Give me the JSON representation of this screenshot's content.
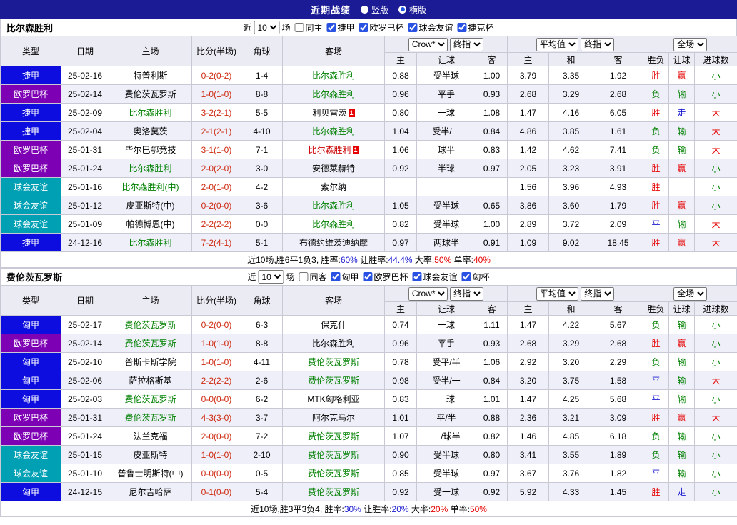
{
  "topbar": {
    "title": "近期战绩",
    "options": [
      {
        "label": "竖版",
        "selected": false
      },
      {
        "label": "横版",
        "selected": true
      }
    ]
  },
  "colors": {
    "topbar_bg": "#1b1b96",
    "header_bg": "#ebebf3",
    "row_alt": "#eeeff9",
    "team_highlight": "#008000",
    "score": "#cf2a10",
    "win": "#e60000",
    "draw": "#1a1ad0",
    "lose": "#008000",
    "leagues": {
      "捷甲": "#0d0de0",
      "欧罗巴杯": "#7e00b4",
      "球会友谊": "#00a0b4",
      "匈甲": "#0d0de0",
      "匈杯": "#00a0b4"
    }
  },
  "table_headers": {
    "type": "类型",
    "date": "日期",
    "home": "主场",
    "score": "比分(半场)",
    "corner": "角球",
    "away": "客场",
    "select_crow": "Crow*",
    "select_final": "终指",
    "select_avg": "平均值",
    "select_full": "全场",
    "sub": [
      "主",
      "让球",
      "客",
      "主",
      "和",
      "客",
      "胜负",
      "让球",
      "进球数"
    ]
  },
  "sections": [
    {
      "team": "比尔森胜利",
      "filter": {
        "prefix": "近",
        "count": "10",
        "suffix": "场",
        "same": {
          "label": "同主",
          "checked": false
        },
        "leagues": [
          {
            "label": "捷甲",
            "checked": true
          },
          {
            "label": "欧罗巴杯",
            "checked": true
          },
          {
            "label": "球会友谊",
            "checked": true
          },
          {
            "label": "捷克杯",
            "checked": true
          }
        ]
      },
      "rows": [
        {
          "league": "捷甲",
          "date": "25-02-16",
          "home": {
            "name": "特普利斯"
          },
          "score": "0-2(0-2)",
          "corner": "1-4",
          "away": {
            "name": "比尔森胜利",
            "green": true
          },
          "crow": [
            "0.88",
            "受半球",
            "1.00"
          ],
          "avg": [
            "3.79",
            "3.35",
            "1.92"
          ],
          "wdl": [
            "胜",
            "r"
          ],
          "handi": [
            "赢",
            "r"
          ],
          "goal": [
            "小",
            "g"
          ]
        },
        {
          "league": "欧罗巴杯",
          "date": "25-02-14",
          "home": {
            "name": "费伦茨瓦罗斯"
          },
          "score": "1-0(1-0)",
          "corner": "8-8",
          "away": {
            "name": "比尔森胜利",
            "green": true
          },
          "crow": [
            "0.96",
            "平手",
            "0.93"
          ],
          "avg": [
            "2.68",
            "3.29",
            "2.68"
          ],
          "wdl": [
            "负",
            "g"
          ],
          "handi": [
            "输",
            "g"
          ],
          "goal": [
            "小",
            "g"
          ]
        },
        {
          "league": "捷甲",
          "date": "25-02-09",
          "home": {
            "name": "比尔森胜利",
            "green": true
          },
          "score": "3-2(2-1)",
          "corner": "5-5",
          "away": {
            "name": "利贝雷茨",
            "redcard": "1"
          },
          "crow": [
            "0.80",
            "一球",
            "1.08"
          ],
          "avg": [
            "1.47",
            "4.16",
            "6.05"
          ],
          "wdl": [
            "胜",
            "r"
          ],
          "handi": [
            "走",
            "b"
          ],
          "goal": [
            "大",
            "r"
          ]
        },
        {
          "league": "捷甲",
          "date": "25-02-04",
          "home": {
            "name": "奥洛莫茨"
          },
          "score": "2-1(2-1)",
          "corner": "4-10",
          "away": {
            "name": "比尔森胜利",
            "green": true
          },
          "crow": [
            "1.04",
            "受半/一",
            "0.84"
          ],
          "avg": [
            "4.86",
            "3.85",
            "1.61"
          ],
          "wdl": [
            "负",
            "g"
          ],
          "handi": [
            "输",
            "g"
          ],
          "goal": [
            "大",
            "r"
          ]
        },
        {
          "league": "欧罗巴杯",
          "date": "25-01-31",
          "home": {
            "name": "毕尔巴鄂竞技"
          },
          "score": "3-1(1-0)",
          "corner": "7-1",
          "away": {
            "name": "比尔森胜利",
            "red": true,
            "redcard": "1"
          },
          "crow": [
            "1.06",
            "球半",
            "0.83"
          ],
          "avg": [
            "1.42",
            "4.62",
            "7.41"
          ],
          "wdl": [
            "负",
            "g"
          ],
          "handi": [
            "输",
            "g"
          ],
          "goal": [
            "大",
            "r"
          ]
        },
        {
          "league": "欧罗巴杯",
          "date": "25-01-24",
          "home": {
            "name": "比尔森胜利",
            "green": true
          },
          "score": "2-0(2-0)",
          "corner": "3-0",
          "away": {
            "name": "安德莱赫特"
          },
          "crow": [
            "0.92",
            "半球",
            "0.97"
          ],
          "avg": [
            "2.05",
            "3.23",
            "3.91"
          ],
          "wdl": [
            "胜",
            "r"
          ],
          "handi": [
            "赢",
            "r"
          ],
          "goal": [
            "小",
            "g"
          ]
        },
        {
          "league": "球会友谊",
          "date": "25-01-16",
          "home": {
            "name": "比尔森胜利(中)",
            "green": true
          },
          "score": "2-0(1-0)",
          "corner": "4-2",
          "away": {
            "name": "索尔纳"
          },
          "crow": [
            "",
            "",
            ""
          ],
          "avg": [
            "1.56",
            "3.96",
            "4.93"
          ],
          "wdl": [
            "胜",
            "r"
          ],
          "handi": [
            "",
            ""
          ],
          "goal": [
            "小",
            "g"
          ]
        },
        {
          "league": "球会友谊",
          "date": "25-01-12",
          "home": {
            "name": "皮亚斯特(中)"
          },
          "score": "0-2(0-0)",
          "corner": "3-6",
          "away": {
            "name": "比尔森胜利",
            "green": true
          },
          "crow": [
            "1.05",
            "受半球",
            "0.65"
          ],
          "avg": [
            "3.86",
            "3.60",
            "1.79"
          ],
          "wdl": [
            "胜",
            "r"
          ],
          "handi": [
            "赢",
            "r"
          ],
          "goal": [
            "小",
            "g"
          ]
        },
        {
          "league": "球会友谊",
          "date": "25-01-09",
          "home": {
            "name": "帕德博恩(中)"
          },
          "score": "2-2(2-2)",
          "corner": "0-0",
          "away": {
            "name": "比尔森胜利",
            "green": true
          },
          "crow": [
            "0.82",
            "受半球",
            "1.00"
          ],
          "avg": [
            "2.89",
            "3.72",
            "2.09"
          ],
          "wdl": [
            "平",
            "b"
          ],
          "handi": [
            "输",
            "g"
          ],
          "goal": [
            "大",
            "r"
          ]
        },
        {
          "league": "捷甲",
          "date": "24-12-16",
          "home": {
            "name": "比尔森胜利",
            "green": true
          },
          "score": "7-2(4-1)",
          "corner": "5-1",
          "away": {
            "name": "布德约维茨迪纳摩"
          },
          "crow": [
            "0.97",
            "两球半",
            "0.91"
          ],
          "avg": [
            "1.09",
            "9.02",
            "18.45"
          ],
          "wdl": [
            "胜",
            "r"
          ],
          "handi": [
            "赢",
            "r"
          ],
          "goal": [
            "大",
            "r"
          ]
        }
      ],
      "summary": [
        {
          "t": "近10场,胜6平1负3, 胜率:",
          "c": "k"
        },
        {
          "t": "60%",
          "c": "b"
        },
        {
          "t": " 让胜率:",
          "c": "k"
        },
        {
          "t": "44.4%",
          "c": "b"
        },
        {
          "t": " 大率:",
          "c": "k"
        },
        {
          "t": "50%",
          "c": "r"
        },
        {
          "t": " 单率:",
          "c": "k"
        },
        {
          "t": "40%",
          "c": "r"
        }
      ]
    },
    {
      "team": "费伦茨瓦罗斯",
      "filter": {
        "prefix": "近",
        "count": "10",
        "suffix": "场",
        "same": {
          "label": "同客",
          "checked": false
        },
        "leagues": [
          {
            "label": "匈甲",
            "checked": true
          },
          {
            "label": "欧罗巴杯",
            "checked": true
          },
          {
            "label": "球会友谊",
            "checked": true
          },
          {
            "label": "匈杯",
            "checked": true
          }
        ]
      },
      "rows": [
        {
          "league": "匈甲",
          "date": "25-02-17",
          "home": {
            "name": "费伦茨瓦罗斯",
            "green": true
          },
          "score": "0-2(0-0)",
          "corner": "6-3",
          "away": {
            "name": "保克什"
          },
          "crow": [
            "0.74",
            "一球",
            "1.11"
          ],
          "avg": [
            "1.47",
            "4.22",
            "5.67"
          ],
          "wdl": [
            "负",
            "g"
          ],
          "handi": [
            "输",
            "g"
          ],
          "goal": [
            "小",
            "g"
          ]
        },
        {
          "league": "欧罗巴杯",
          "date": "25-02-14",
          "home": {
            "name": "费伦茨瓦罗斯",
            "green": true
          },
          "score": "1-0(1-0)",
          "corner": "8-8",
          "away": {
            "name": "比尔森胜利"
          },
          "crow": [
            "0.96",
            "平手",
            "0.93"
          ],
          "avg": [
            "2.68",
            "3.29",
            "2.68"
          ],
          "wdl": [
            "胜",
            "r"
          ],
          "handi": [
            "赢",
            "r"
          ],
          "goal": [
            "小",
            "g"
          ]
        },
        {
          "league": "匈甲",
          "date": "25-02-10",
          "home": {
            "name": "普斯卡斯学院"
          },
          "score": "1-0(1-0)",
          "corner": "4-11",
          "away": {
            "name": "费伦茨瓦罗斯",
            "green": true
          },
          "crow": [
            "0.78",
            "受平/半",
            "1.06"
          ],
          "avg": [
            "2.92",
            "3.20",
            "2.29"
          ],
          "wdl": [
            "负",
            "g"
          ],
          "handi": [
            "输",
            "g"
          ],
          "goal": [
            "小",
            "g"
          ]
        },
        {
          "league": "匈甲",
          "date": "25-02-06",
          "home": {
            "name": "萨拉格斯基"
          },
          "score": "2-2(2-2)",
          "corner": "2-6",
          "away": {
            "name": "费伦茨瓦罗斯",
            "green": true
          },
          "crow": [
            "0.98",
            "受半/一",
            "0.84"
          ],
          "avg": [
            "3.20",
            "3.75",
            "1.58"
          ],
          "wdl": [
            "平",
            "b"
          ],
          "handi": [
            "输",
            "g"
          ],
          "goal": [
            "大",
            "r"
          ]
        },
        {
          "league": "匈甲",
          "date": "25-02-03",
          "home": {
            "name": "费伦茨瓦罗斯",
            "green": true
          },
          "score": "0-0(0-0)",
          "corner": "6-2",
          "away": {
            "name": "MTK匈格利亚"
          },
          "crow": [
            "0.83",
            "一球",
            "1.01"
          ],
          "avg": [
            "1.47",
            "4.25",
            "5.68"
          ],
          "wdl": [
            "平",
            "b"
          ],
          "handi": [
            "输",
            "g"
          ],
          "goal": [
            "小",
            "g"
          ]
        },
        {
          "league": "欧罗巴杯",
          "date": "25-01-31",
          "home": {
            "name": "费伦茨瓦罗斯",
            "green": true
          },
          "score": "4-3(3-0)",
          "corner": "3-7",
          "away": {
            "name": "阿尔克马尔"
          },
          "crow": [
            "1.01",
            "平/半",
            "0.88"
          ],
          "avg": [
            "2.36",
            "3.21",
            "3.09"
          ],
          "wdl": [
            "胜",
            "r"
          ],
          "handi": [
            "赢",
            "r"
          ],
          "goal": [
            "大",
            "r"
          ]
        },
        {
          "league": "欧罗巴杯",
          "date": "25-01-24",
          "home": {
            "name": "法兰克福"
          },
          "score": "2-0(0-0)",
          "corner": "7-2",
          "away": {
            "name": "费伦茨瓦罗斯",
            "green": true
          },
          "crow": [
            "1.07",
            "一/球半",
            "0.82"
          ],
          "avg": [
            "1.46",
            "4.85",
            "6.18"
          ],
          "wdl": [
            "负",
            "g"
          ],
          "handi": [
            "输",
            "g"
          ],
          "goal": [
            "小",
            "g"
          ]
        },
        {
          "league": "球会友谊",
          "date": "25-01-15",
          "home": {
            "name": "皮亚斯特"
          },
          "score": "1-0(1-0)",
          "corner": "2-10",
          "away": {
            "name": "费伦茨瓦罗斯",
            "green": true
          },
          "crow": [
            "0.90",
            "受半球",
            "0.80"
          ],
          "avg": [
            "3.41",
            "3.55",
            "1.89"
          ],
          "wdl": [
            "负",
            "g"
          ],
          "handi": [
            "输",
            "g"
          ],
          "goal": [
            "小",
            "g"
          ]
        },
        {
          "league": "球会友谊",
          "date": "25-01-10",
          "home": {
            "name": "普鲁士明斯特(中)"
          },
          "score": "0-0(0-0)",
          "corner": "0-5",
          "away": {
            "name": "费伦茨瓦罗斯",
            "green": true
          },
          "crow": [
            "0.85",
            "受半球",
            "0.97"
          ],
          "avg": [
            "3.67",
            "3.76",
            "1.82"
          ],
          "wdl": [
            "平",
            "b"
          ],
          "handi": [
            "输",
            "g"
          ],
          "goal": [
            "小",
            "g"
          ]
        },
        {
          "league": "匈甲",
          "date": "24-12-15",
          "home": {
            "name": "尼尔吉哈萨"
          },
          "score": "0-1(0-0)",
          "corner": "5-4",
          "away": {
            "name": "费伦茨瓦罗斯",
            "green": true
          },
          "crow": [
            "0.92",
            "受一球",
            "0.92"
          ],
          "avg": [
            "5.92",
            "4.33",
            "1.45"
          ],
          "wdl": [
            "胜",
            "r"
          ],
          "handi": [
            "走",
            "b"
          ],
          "goal": [
            "小",
            "g"
          ]
        }
      ],
      "summary": [
        {
          "t": "近10场,胜3平3负4, 胜率:",
          "c": "k"
        },
        {
          "t": "30%",
          "c": "b"
        },
        {
          "t": " 让胜率:",
          "c": "k"
        },
        {
          "t": "20%",
          "c": "b"
        },
        {
          "t": " 大率:",
          "c": "k"
        },
        {
          "t": "20%",
          "c": "r"
        },
        {
          "t": " 单率:",
          "c": "k"
        },
        {
          "t": "50%",
          "c": "r"
        }
      ]
    }
  ]
}
